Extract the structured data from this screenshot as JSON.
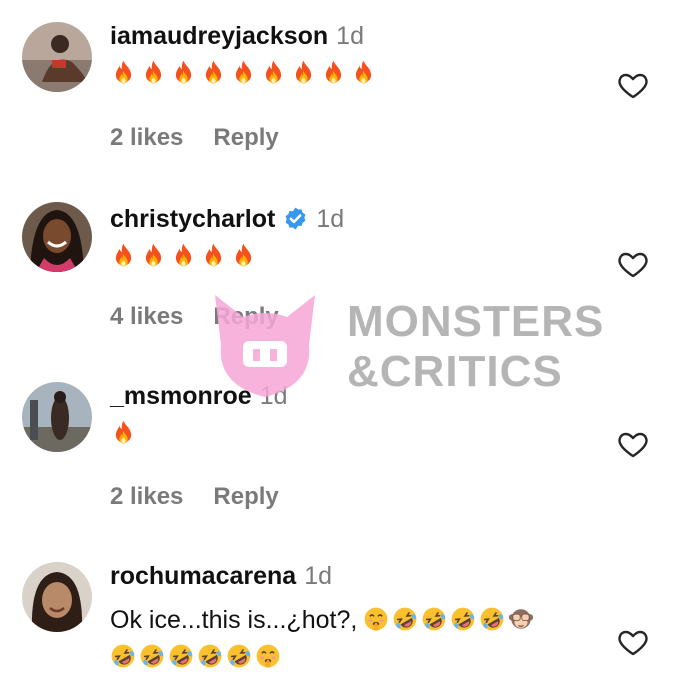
{
  "comments": [
    {
      "username": "iamaudreyjackson",
      "time": "1d",
      "verified": false,
      "likes": "2 likes",
      "reply": "Reply",
      "fire_count": 9
    },
    {
      "username": "christycharlot",
      "time": "1d",
      "verified": true,
      "likes": "4 likes",
      "reply": "Reply",
      "fire_count": 5
    },
    {
      "username": "_msmonroe",
      "time": "1d",
      "verified": false,
      "likes": "2 likes",
      "reply": "Reply",
      "fire_count": 1
    },
    {
      "username": "rochumacarena",
      "time": "1d",
      "verified": false,
      "text": "Ok ice...this is...¿hot?,"
    }
  ],
  "watermark": {
    "line1": "MONSTERS",
    "line2": "&CRITICS"
  },
  "colors": {
    "username": "#111111",
    "muted": "#7a7a7a",
    "verified": "#3897f0",
    "watermark_logo": "#f7a6d8",
    "watermark_text": "#a9a9a9"
  },
  "icons": [
    "heart-outline-icon",
    "verified-badge-icon",
    "fire-emoji",
    "rofl-emoji",
    "shush-emoji",
    "see-no-evil-monkey-emoji"
  ]
}
